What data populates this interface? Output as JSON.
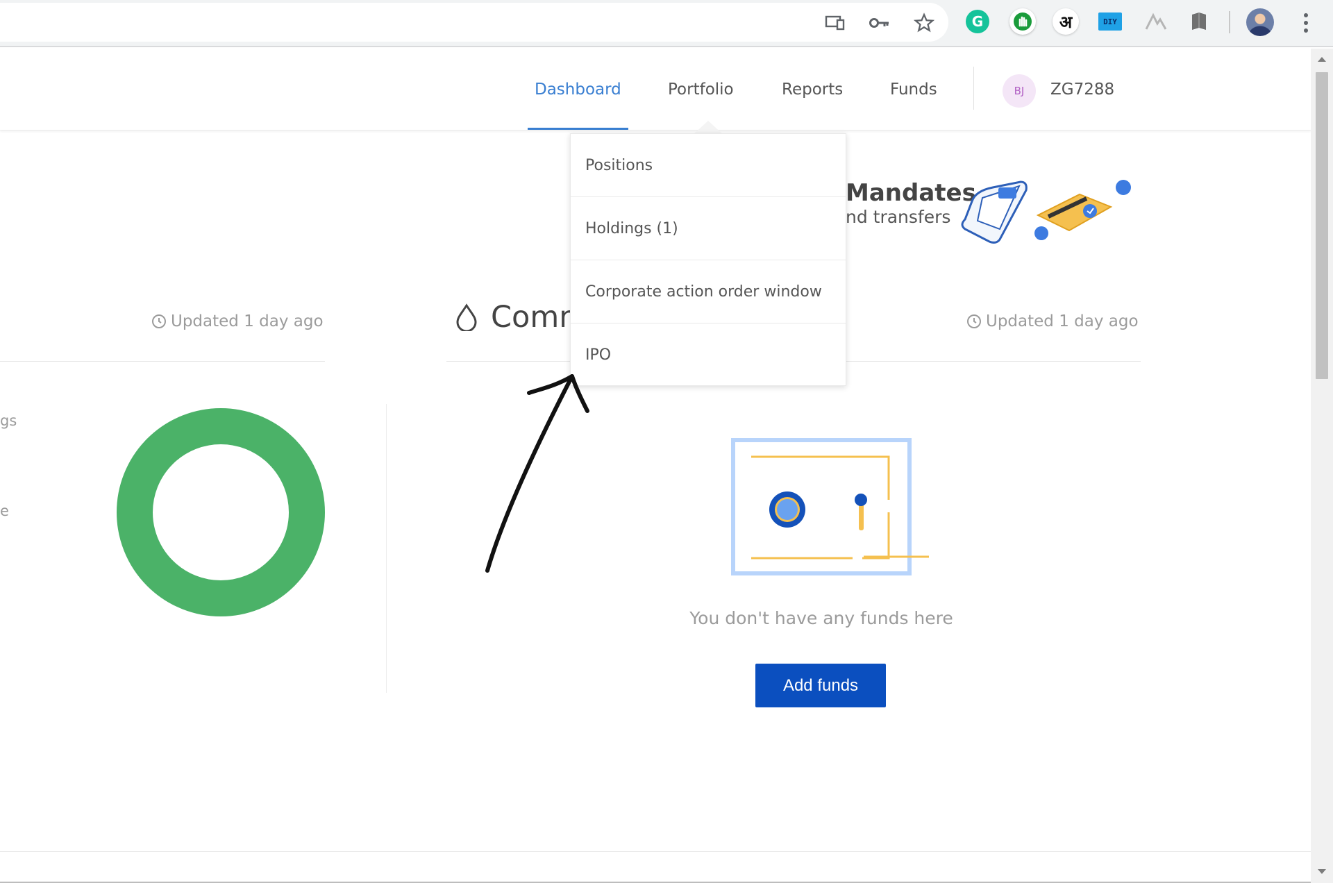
{
  "browser": {
    "extensions": [
      {
        "name": "cast-icon"
      },
      {
        "name": "key-icon"
      },
      {
        "name": "star-icon"
      },
      {
        "name": "grammarly-icon",
        "glyph": "G",
        "color": "#15c39a"
      },
      {
        "name": "hand-icon",
        "color": "#1a9c3b"
      },
      {
        "name": "hindi-icon",
        "glyph": "अ"
      },
      {
        "name": "diy-icon",
        "glyph": "DIY",
        "color": "#1fa1e6"
      },
      {
        "name": "mountain-icon"
      },
      {
        "name": "book-icon"
      }
    ]
  },
  "header": {
    "nav": [
      "Dashboard",
      "Portfolio",
      "Reports",
      "Funds"
    ],
    "active_nav": "Dashboard",
    "avatar_initials": "BJ",
    "user_id": "ZG7288"
  },
  "dropdown": {
    "items": [
      "Positions",
      "Holdings (1)",
      "Corporate action order window",
      "IPO"
    ]
  },
  "banner": {
    "title": "Mandates",
    "subtitle": "nd transfers"
  },
  "left_panel": {
    "updated": "Updated 1 day ago",
    "legend_fragments": [
      "gs",
      "e"
    ],
    "donut_color": "#4bb268"
  },
  "commodity": {
    "title": "Comm",
    "updated": "Updated 1 day ago",
    "empty_message": "You don't have any funds here",
    "add_funds_label": "Add funds"
  },
  "colors": {
    "accent": "#387ed1",
    "button": "#0b4fbf",
    "donut": "#4bb268"
  }
}
